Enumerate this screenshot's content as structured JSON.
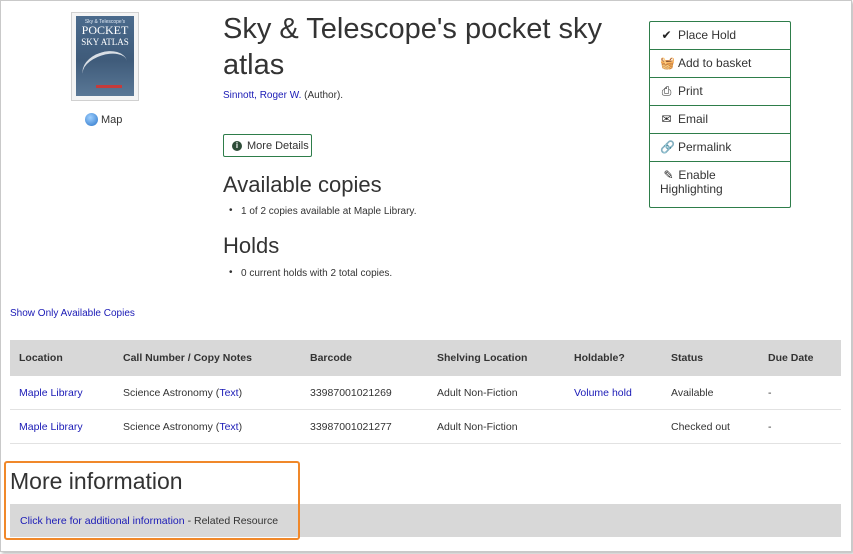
{
  "record": {
    "title": "Sky & Telescope's pocket sky atlas",
    "author_name": "Sinnott, Roger W.",
    "author_role": "(Author).",
    "cover": {
      "small_text": "Sky & Telescope's",
      "big_line1": "POCKET",
      "big_line2": "SKY ATLAS"
    },
    "map_label": "Map",
    "more_details_label": "More Details"
  },
  "available": {
    "heading": "Available copies",
    "summary": "1 of 2 copies available at Maple Library."
  },
  "holds": {
    "heading": "Holds",
    "summary": "0 current holds with 2 total copies."
  },
  "actions": [
    {
      "label": "Place Hold",
      "icon": "check-icon"
    },
    {
      "label": "Add to basket",
      "icon": "basket-icon"
    },
    {
      "label": "Print",
      "icon": "print-icon"
    },
    {
      "label": "Email",
      "icon": "email-icon"
    },
    {
      "label": "Permalink",
      "icon": "link-icon"
    },
    {
      "label": "Enable Highlighting",
      "label_line1": "Enable",
      "label_line2": "Highlighting",
      "icon": "highlighter-icon"
    }
  ],
  "show_only_label": "Show Only Available Copies",
  "copies_table": {
    "headers": [
      "Location",
      "Call Number / Copy Notes",
      "Barcode",
      "Shelving Location",
      "Holdable?",
      "Status",
      "Due Date"
    ],
    "rows": [
      {
        "location": "Maple Library",
        "call_number": "Science Astronomy",
        "text_link": "Text",
        "barcode": "33987001021269",
        "shelving": "Adult Non-Fiction",
        "holdable": "Volume hold",
        "status": "Available",
        "due": "-"
      },
      {
        "location": "Maple Library",
        "call_number": "Science Astronomy",
        "text_link": "Text",
        "barcode": "33987001021277",
        "shelving": "Adult Non-Fiction",
        "holdable": "",
        "status": "Checked out",
        "due": "-"
      }
    ]
  },
  "more_info": {
    "heading": "More information",
    "link_label": "Click here for additional information",
    "suffix": "- Related Resource"
  },
  "colors": {
    "accent_border": "#2e7d4a",
    "link": "#1a1ab6",
    "highlight_box": "#f0882a",
    "table_header_bg": "#d8d8d8"
  }
}
